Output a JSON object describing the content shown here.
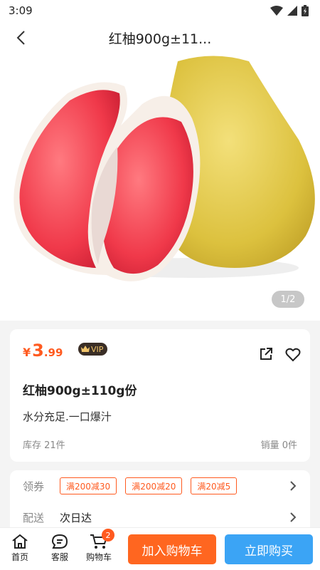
{
  "status_bar": {
    "time": "3:09"
  },
  "nav": {
    "title": "红柚900g±11..."
  },
  "hero": {
    "pager": "1/2"
  },
  "product": {
    "price_symbol": "¥",
    "price_int": "3",
    "price_dec": ".99",
    "vip_label": "VIP",
    "name": "红柚900g±110g份",
    "desc": "水分充足.一口爆汁",
    "stock": "库存 21件",
    "sales": "销量 0件"
  },
  "info": {
    "coupon_label": "领券",
    "coupons": [
      "满200减30",
      "满200减20",
      "满20减5"
    ],
    "delivery_label": "配送",
    "delivery_value": "次日达"
  },
  "bottom": {
    "home": "首页",
    "service": "客服",
    "cart": "购物车",
    "cart_count": "2",
    "add_to_cart": "加入购物车",
    "buy_now": "立即购买"
  },
  "colors": {
    "accent": "#ff5a1f",
    "buy": "#3ba4f5"
  }
}
